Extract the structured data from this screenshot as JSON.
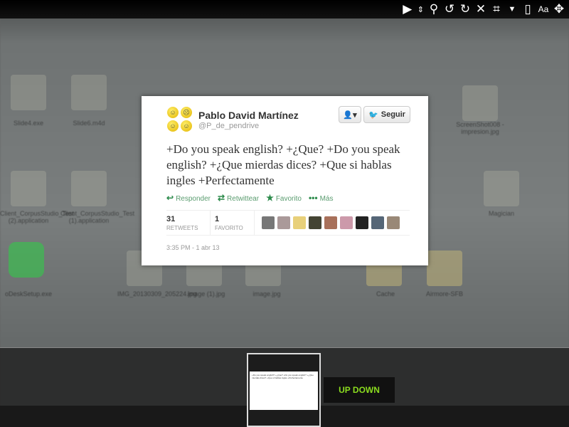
{
  "viewer_toolbar": {
    "icons": [
      "play-icon",
      "zoom-arrows-icon",
      "magnifier-icon",
      "rotate-left-icon",
      "rotate-right-icon",
      "close-icon",
      "crop-icon",
      "dropdown-icon",
      "document-icon",
      "text-size-icon",
      "move-icon"
    ]
  },
  "background": {
    "labels": [
      "Slide4.exe",
      "Slide6.m4d",
      "Client_CorpusStudio_Test (2).application",
      "Client_CorpusStudio_Test (1).application",
      "oDeskSetup.exe",
      "IMG_20130309_205224.jpg",
      "image (1).jpg",
      "image.jpg",
      "Cache",
      "Airmore-SFB",
      "ScreenShot008 - impresion.jpg",
      "Magician"
    ]
  },
  "tweet": {
    "name": "Pablo David Martínez",
    "handle": "@P_de_pendrive",
    "follow_label": "Seguir",
    "text": "+Do you speak english? +¿Que? +Do you speak english? +¿Que mierdas dices?    +Que si hablas ingles +Perfectamente",
    "actions": [
      {
        "icon": "reply-icon",
        "label": "Responder"
      },
      {
        "icon": "retweet-icon",
        "label": "Retwittear"
      },
      {
        "icon": "star-icon",
        "label": "Favorito"
      },
      {
        "icon": "more-icon",
        "label": "Más"
      }
    ],
    "retweets": {
      "count": "31",
      "label": "RETWEETS"
    },
    "favorites": {
      "count": "1",
      "label": "FAVORITO"
    },
    "timestamp": "3:35 PM - 1 abr 13",
    "accent": "#2b8a4a"
  },
  "filmstrip": {
    "thumbnail_2_logo": "UP DOWN"
  }
}
